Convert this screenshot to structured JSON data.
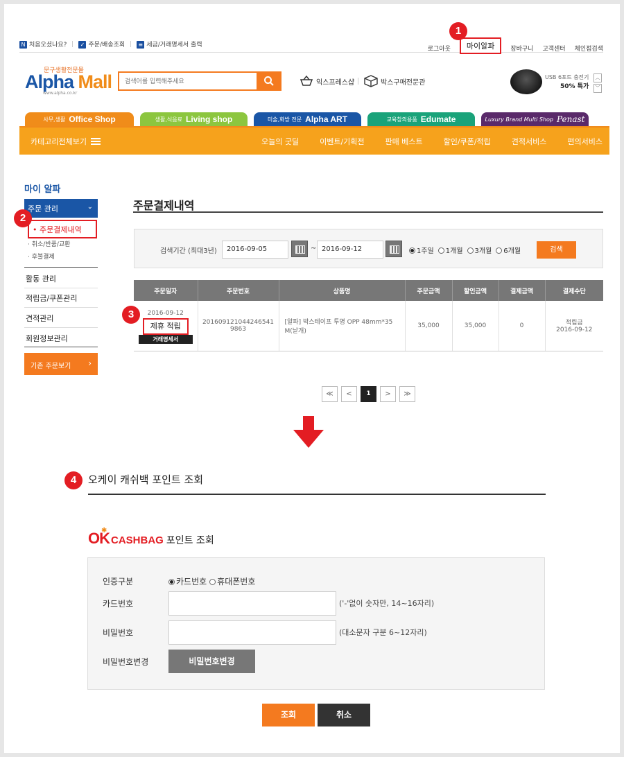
{
  "util": {
    "left": [
      "처음오셨나요?",
      "주문/배송조회",
      "세금/거래명세서 출력"
    ],
    "right": [
      "로그아웃",
      "마이알파",
      "장바구니",
      "고객센터",
      "체인점검색"
    ]
  },
  "badges": [
    "1",
    "2",
    "3",
    "4"
  ],
  "logo": {
    "sub": "문구생활전문몰",
    "alpha": "Alpha",
    "mall": "Mall",
    "url": "www.alpha.co.kr"
  },
  "search": {
    "placeholder": "검색어를 입력해주세요"
  },
  "header_links": [
    "익스프레스샵",
    "박스구매전문관"
  ],
  "promo": {
    "line1": "USB 6포트 충전기",
    "line2": "50% 특가"
  },
  "shop_tabs": [
    {
      "small": "사무,생활",
      "big": "Office Shop",
      "color": "#f08c1a"
    },
    {
      "small": "생활,식음료",
      "big": "Living shop",
      "color": "#8cc63f"
    },
    {
      "small": "미술,화방 전문",
      "big": "Alpha ART",
      "color": "#1a56a6"
    },
    {
      "small": "교육창의용품",
      "big": "Edumate",
      "color": "#1aa37a"
    },
    {
      "small": "Luxury Brand Multi Shop",
      "big": "Penast",
      "color": "#5a2a6a"
    }
  ],
  "nav": {
    "category_all": "카테고리전체보기",
    "items": [
      "오늘의 굿딜",
      "이벤트/기획전",
      "판매 베스트",
      "할인/쿠폰/적립",
      "견적서비스",
      "편의서비스"
    ]
  },
  "sidebar": {
    "title": "마이 알파",
    "group": "주문 관리",
    "selected": "• 주문결제내역",
    "subs": [
      "· 취소/반품/교환",
      "· 후불결제"
    ],
    "items": [
      "활동 관리",
      "적립금/쿠폰관리",
      "견적관리",
      "회원정보관리"
    ],
    "button": "기존 주문보기"
  },
  "main": {
    "title": "주문결제내역",
    "filter_label": "검색기간 (최대3년)",
    "date_from": "2016-09-05",
    "date_to": "2016-09-12",
    "tilde": "~",
    "periods": [
      "1주일",
      "1개월",
      "3개월",
      "6개월"
    ],
    "search_btn": "검색"
  },
  "table": {
    "headers": [
      "주문일자",
      "주문번호",
      "상품명",
      "주문금액",
      "할인금액",
      "결제금액",
      "결제수단"
    ],
    "row": {
      "date": "2016-09-12",
      "partner_btn": "제휴 적립",
      "receipt_btn": "거래명세서",
      "order_no_1": "201609121044246541",
      "order_no_2": "9863",
      "product_1": "[알파] 박스테이프 투명 OPP 48mm*35",
      "product_2": "M(낱개)",
      "order_amount": "35,000",
      "discount": "35,000",
      "paid": "0",
      "method_1": "적립금",
      "method_2": "2016-09-12"
    }
  },
  "pager": {
    "first": "≪",
    "prev": "<",
    "current": "1",
    "next": ">",
    "last": "≫"
  },
  "okcashbag": {
    "section_title": "오케이 캐쉬백 포인트 조회",
    "logo_ok": "OK",
    "logo_cashbag": "CASHBAG",
    "logo_suffix": "포인트 조회",
    "auth_label": "인증구분",
    "auth_options": [
      "카드번호",
      "휴대폰번호"
    ],
    "card_label": "카드번호",
    "card_hint": "('-'없이 숫자만, 14~16자리)",
    "pw_label": "비밀번호",
    "pw_hint": "(대소문자 구분 6~12자리)",
    "pw_change_label": "비밀번호변경",
    "pw_change_btn": "비밀번호변경",
    "query_btn": "조회",
    "cancel_btn": "취소"
  }
}
